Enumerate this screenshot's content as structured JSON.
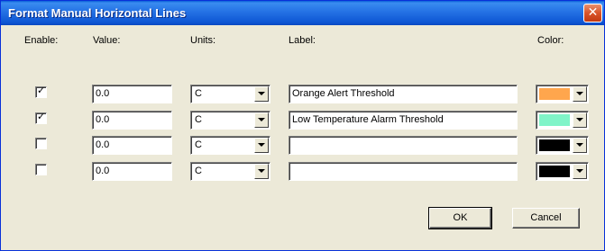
{
  "window": {
    "title": "Format Manual Horizontal Lines",
    "close_glyph": "✕"
  },
  "headers": {
    "enable": "Enable:",
    "value": "Value:",
    "units": "Units:",
    "label": "Label:",
    "color": "Color:"
  },
  "rows": [
    {
      "enabled": true,
      "value": "0.0",
      "units": "C",
      "label": "Orange Alert Threshold",
      "color": "#ffa64d"
    },
    {
      "enabled": true,
      "value": "0.0",
      "units": "C",
      "label": "Low Temperature Alarm Threshold",
      "color": "#80f4c8"
    },
    {
      "enabled": false,
      "value": "0.0",
      "units": "C",
      "label": "",
      "color": "#000000"
    },
    {
      "enabled": false,
      "value": "0.0",
      "units": "C",
      "label": "",
      "color": "#000000"
    }
  ],
  "buttons": {
    "ok": "OK",
    "cancel": "Cancel"
  },
  "icons": {
    "checkmark": "check-icon",
    "dropdown": "chevron-down-icon",
    "close": "close-icon"
  }
}
